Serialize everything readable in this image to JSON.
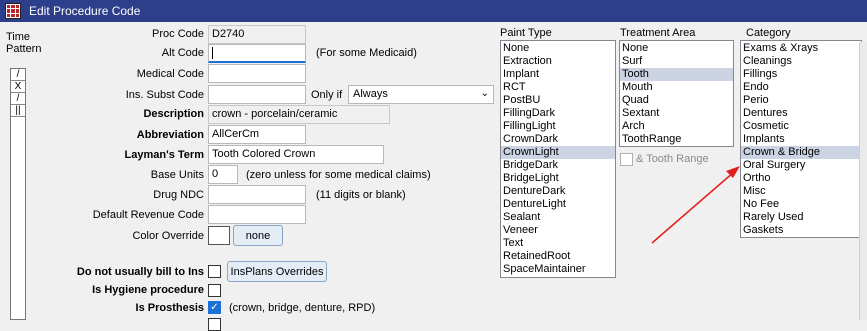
{
  "window": {
    "title": "Edit Procedure Code"
  },
  "time_pattern": {
    "label1": "Time",
    "label2": "Pattern",
    "cells": [
      "/",
      "X",
      "/",
      "||"
    ]
  },
  "form": {
    "proc_code": {
      "label": "Proc Code",
      "value": "D2740"
    },
    "alt_code": {
      "label": "Alt Code",
      "value": "",
      "hint": "(For some Medicaid)"
    },
    "medical_code": {
      "label": "Medical Code",
      "value": ""
    },
    "ins_subst_code": {
      "label": "Ins. Subst Code",
      "value": "",
      "only_if_label": "Only if",
      "only_if_value": "Always"
    },
    "description": {
      "label": "Description",
      "value": "crown - porcelain/ceramic"
    },
    "abbreviation": {
      "label": "Abbreviation",
      "value": "AllCerCm"
    },
    "laymans_term": {
      "label": "Layman's Term",
      "value": "Tooth Colored Crown"
    },
    "base_units": {
      "label": "Base Units",
      "value": "0",
      "hint": "(zero unless for some medical claims)"
    },
    "drug_ndc": {
      "label": "Drug NDC",
      "value": "",
      "hint": "(11 digits or blank)"
    },
    "default_revenue_code": {
      "label": "Default Revenue Code",
      "value": ""
    },
    "color_override": {
      "label": "Color Override",
      "button": "none"
    },
    "do_not_bill": {
      "label": "Do not usually bill to Ins",
      "checked": false,
      "button": "InsPlans Overrides"
    },
    "is_hygiene": {
      "label": "Is Hygiene procedure",
      "checked": false
    },
    "is_prosthesis": {
      "label": "Is Prosthesis",
      "checked": true,
      "hint": "(crown, bridge, denture, RPD)"
    }
  },
  "paint_type": {
    "title": "Paint Type",
    "selected": "CrownLight",
    "items": [
      "None",
      "Extraction",
      "Implant",
      "RCT",
      "PostBU",
      "FillingDark",
      "FillingLight",
      "CrownDark",
      "CrownLight",
      "BridgeDark",
      "BridgeLight",
      "DentureDark",
      "DentureLight",
      "Sealant",
      "Veneer",
      "Text",
      "RetainedRoot",
      "SpaceMaintainer"
    ]
  },
  "treatment_area": {
    "title": "Treatment Area",
    "selected": "Tooth",
    "items": [
      "None",
      "Surf",
      "Tooth",
      "Mouth",
      "Quad",
      "Sextant",
      "Arch",
      "ToothRange"
    ],
    "tooth_range_label": "& Tooth Range"
  },
  "category": {
    "title": "Category",
    "selected": "Crown & Bridge",
    "items": [
      "Exams & Xrays",
      "Cleanings",
      "Fillings",
      "Endo",
      "Perio",
      "Dentures",
      "Cosmetic",
      "Implants",
      "Crown & Bridge",
      "Oral Surgery",
      "Ortho",
      "Misc",
      "No Fee",
      "Rarely Used",
      "Gaskets"
    ]
  },
  "colors": {
    "titlebar": "#2d3f8a",
    "selection": "#ccd4e4",
    "annotation_arrow": "#e0201c",
    "focus": "#1c70d6"
  }
}
